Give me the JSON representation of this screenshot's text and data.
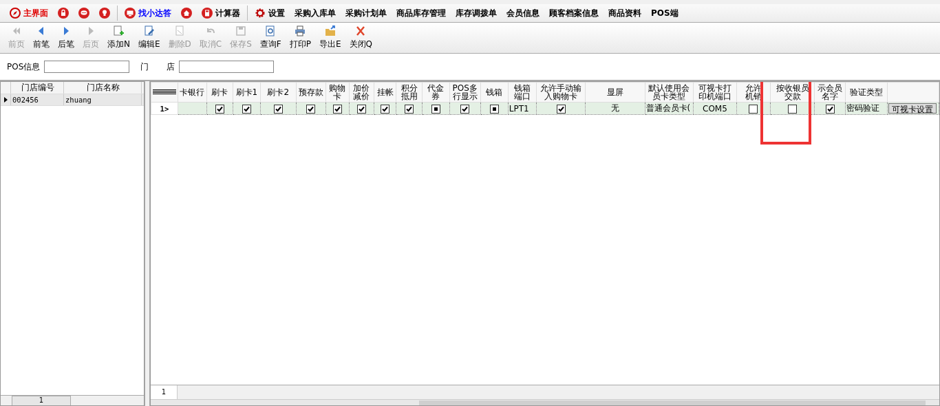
{
  "nav": [
    {
      "label": "主界面",
      "kind": "compass",
      "color": "#e00000"
    },
    {
      "kind": "lock"
    },
    {
      "kind": "chat"
    },
    {
      "kind": "bulb"
    },
    {
      "label": "找小达答",
      "kind": "monitor",
      "color": "#0000ff",
      "sep": true
    },
    {
      "kind": "home"
    },
    {
      "label": "计算器",
      "kind": "calc"
    },
    {
      "label": "设置",
      "kind": "gear",
      "sep": true
    },
    {
      "label": "采购入库单",
      "kind": "none"
    },
    {
      "label": "采购计划单",
      "kind": "none"
    },
    {
      "label": "商品库存管理",
      "kind": "none"
    },
    {
      "label": "库存调拨单",
      "kind": "none"
    },
    {
      "label": "会员信息",
      "kind": "none"
    },
    {
      "label": "顾客档案信息",
      "kind": "none"
    },
    {
      "label": "商品资料",
      "kind": "none"
    },
    {
      "label": "POS端",
      "kind": "none"
    }
  ],
  "toolbar": [
    {
      "label": "前页",
      "kind": "first",
      "disabled": true
    },
    {
      "label": "前笔",
      "kind": "prev",
      "disabled": false
    },
    {
      "label": "后笔",
      "kind": "next",
      "disabled": false
    },
    {
      "label": "后页",
      "kind": "last",
      "disabled": true
    },
    {
      "label": "添加N",
      "kind": "add",
      "disabled": false
    },
    {
      "label": "编辑E",
      "kind": "edit",
      "disabled": false
    },
    {
      "label": "删除D",
      "kind": "delete",
      "disabled": true
    },
    {
      "label": "取消C",
      "kind": "undo",
      "disabled": true
    },
    {
      "label": "保存S",
      "kind": "save",
      "disabled": true
    },
    {
      "label": "查询F",
      "kind": "query",
      "disabled": false
    },
    {
      "label": "打印P",
      "kind": "print",
      "disabled": false
    },
    {
      "label": "导出E",
      "kind": "export",
      "disabled": false
    },
    {
      "label": "关闭Q",
      "kind": "close",
      "disabled": false
    }
  ],
  "filter": {
    "pos_label": "POS信息",
    "store_label_1": "门",
    "store_label_2": "店"
  },
  "stores": {
    "columns": [
      "门店编号",
      "门店名称"
    ],
    "rows": [
      {
        "code": "002456",
        "name": "zhuang",
        "selected": true
      }
    ],
    "footer": "1"
  },
  "grid": {
    "columns": [
      {
        "label": "卡银行"
      },
      {
        "label": "刷卡"
      },
      {
        "label": "刷卡1"
      },
      {
        "label": "刷卡2"
      },
      {
        "label": "预存款"
      },
      {
        "label": "购物卡"
      },
      {
        "label": "加价减价"
      },
      {
        "label": "挂帐"
      },
      {
        "label": "积分抵用"
      },
      {
        "label": "代金券"
      },
      {
        "label": "POS多行显示"
      },
      {
        "label": "钱箱"
      },
      {
        "label": "钱箱端口"
      },
      {
        "label": "允许手动输入购物卡"
      },
      {
        "label": "显屏"
      },
      {
        "label": "默认使用会员卡类型"
      },
      {
        "label": "可视卡打印机端口"
      },
      {
        "label": "允许机销"
      },
      {
        "label": "按收银员交款"
      },
      {
        "label": "示会员名字"
      },
      {
        "label": "验证类型"
      },
      {}
    ],
    "row_header": "1>",
    "rows": [
      [
        {
          "kind": "text"
        },
        {
          "kind": "check",
          "checked": true
        },
        {
          "kind": "check",
          "checked": true
        },
        {
          "kind": "check",
          "checked": true
        },
        {
          "kind": "check",
          "checked": true
        },
        {
          "kind": "check",
          "checked": true
        },
        {
          "kind": "check",
          "checked": true
        },
        {
          "kind": "check",
          "checked": true
        },
        {
          "kind": "check",
          "checked": true
        },
        {
          "kind": "square",
          "checked": true
        },
        {
          "kind": "check",
          "checked": true
        },
        {
          "kind": "square",
          "checked": true
        },
        {
          "kind": "text",
          "text": "LPT1"
        },
        {
          "kind": "check",
          "checked": true
        },
        {
          "kind": "text",
          "text": "无"
        },
        {
          "kind": "text",
          "text": "普通会员卡("
        },
        {
          "kind": "text",
          "text": "COM5"
        },
        {
          "kind": "check",
          "checked": false
        },
        {
          "kind": "check",
          "checked": false
        },
        {
          "kind": "check",
          "checked": true
        },
        {
          "kind": "text",
          "text": "密码验证"
        },
        {
          "kind": "button",
          "text": "可视卡设置"
        }
      ]
    ],
    "footer": "1"
  }
}
